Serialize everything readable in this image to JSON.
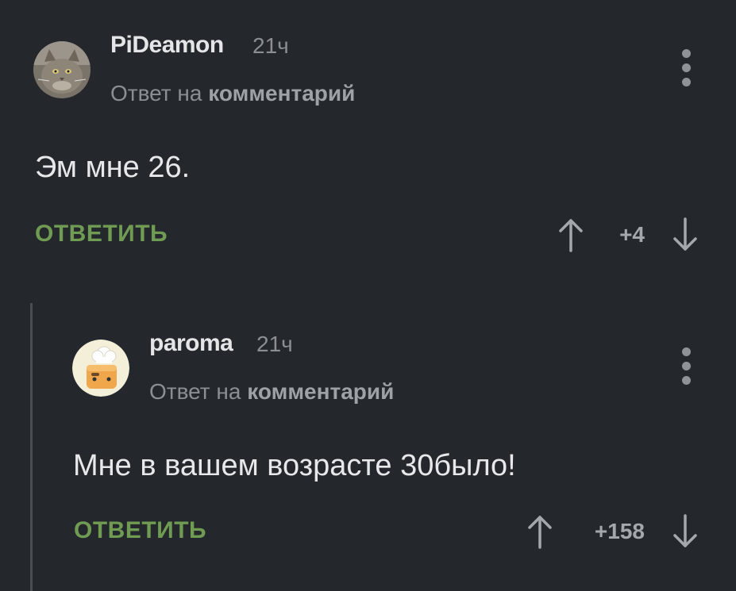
{
  "comments": [
    {
      "username": "PiDeamon",
      "time": "21ч",
      "reply_prefix": "Ответ на",
      "reply_link": "комментарий",
      "text": "Эм мне 26.",
      "reply_label": "ОТВЕТИТЬ",
      "rating": "+4",
      "avatar_icon": "cat-avatar-icon"
    },
    {
      "username": "paroma",
      "time": "21ч",
      "reply_prefix": "Ответ на",
      "reply_link": "комментарий",
      "text": "Мне в вашем возрасте 30было!",
      "reply_label": "ОТВЕТИТЬ",
      "rating": "+158",
      "avatar_icon": "chef-toaster-avatar-icon"
    }
  ],
  "colors": {
    "background": "#24272b",
    "accent_green": "#6f9b53",
    "muted_text": "#8b8f93"
  }
}
